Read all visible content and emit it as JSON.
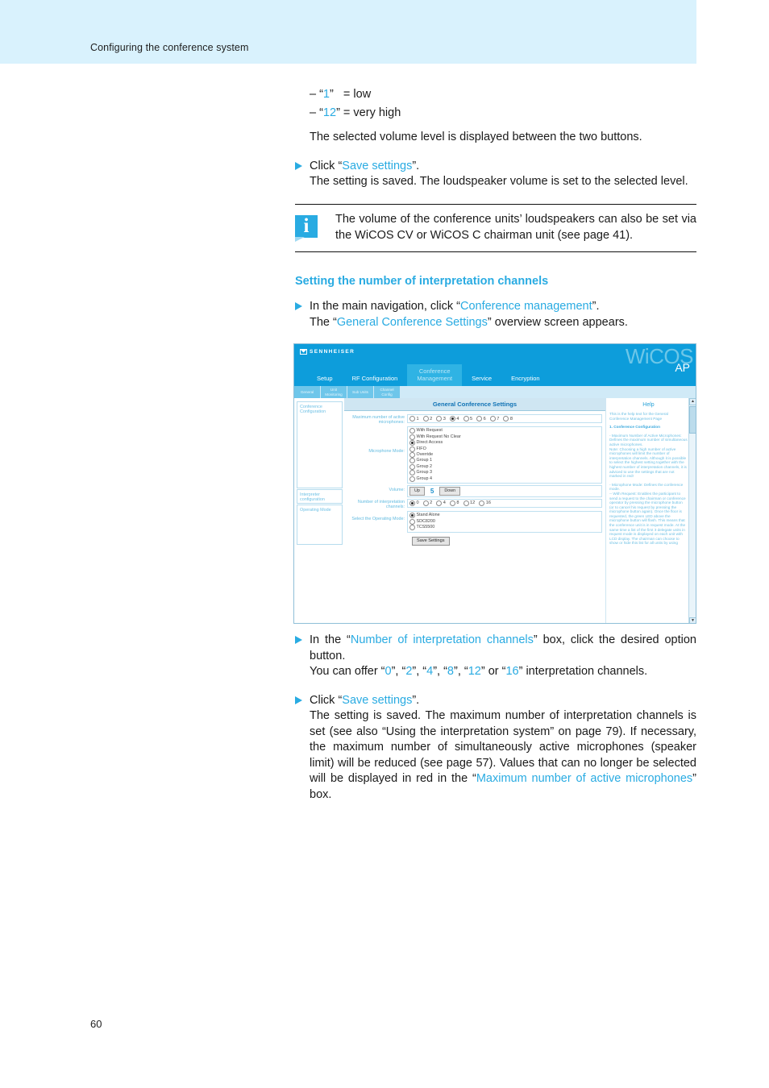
{
  "header": {
    "running_title": "Configuring the conference system"
  },
  "page_number": "60",
  "volume_levels": [
    {
      "dash": "– “",
      "value": "1",
      "close": "”",
      "equals": "   = low"
    },
    {
      "dash": "– “",
      "value": "12",
      "close": "”",
      "equals": " = very high"
    }
  ],
  "intro": {
    "selected_level_note": "The selected volume level is displayed between the two buttons."
  },
  "steps": {
    "save_click_prefix": "Click “",
    "save_link": "Save settings",
    "save_click_suffix": "”.",
    "save_result_1": "The setting is saved. The loudspeaker volume is set to the selected level.",
    "nav_prefix": "In the main navigation, click “",
    "nav_link": "Conference management",
    "nav_suffix": "”.",
    "nav_result_prefix": "The “",
    "nav_result_link": "General Conference Settings",
    "nav_result_suffix": "” overview screen appears.",
    "channels_prefix": "In the “",
    "channels_link": "Number of interpretation channels",
    "channels_suffix": "” box, click the desired option button.",
    "channels_offer_prefix": "You can offer “",
    "channels_offer_values": [
      "0",
      "2",
      "4",
      "8",
      "12",
      "16"
    ],
    "channels_offer_suffix": "” interpretation channels.",
    "save_result_2_a": "The setting is saved. The maximum number of interpretation channels is set (see also “Using the interpretation system” on page 79). If necessary, the maximum number of simultaneously active microphones (speaker limit) will be reduced (see page 57). Values that can no longer be selected will be displayed in red in the “",
    "save_result_2_link": "Maximum number of active microphones",
    "save_result_2_b": "” box."
  },
  "note": {
    "icon": "info-icon",
    "glyph": "i",
    "text": "The volume of the conference units’ loudspeakers can also be set via the WiCOS CV or WiCOS C chairman unit (see page 41)."
  },
  "section": {
    "heading": "Setting the number of interpretation channels"
  },
  "screenshot": {
    "brand": "SENNHEISER",
    "product": "WiCOS",
    "product_variant": "AP",
    "tabs": [
      {
        "label": "Setup",
        "active": false
      },
      {
        "label": "RF Configuration",
        "active": false
      },
      {
        "label": "Conference\nManagement",
        "active": true
      },
      {
        "label": "Service",
        "active": false
      },
      {
        "label": "Encryption",
        "active": false
      }
    ],
    "subtabs": [
      "General",
      "Unit\nMonitoring",
      "Sub Units",
      "Channel\nConfig"
    ],
    "sidebar": [
      "Conference\nConfiguration",
      "Interpreter\nconfiguration",
      "Operating Mode"
    ],
    "panel_title": "General Conference Settings",
    "fields": {
      "max_mics_label": "Maximum number of active\nmicrophones:",
      "max_mics_options": [
        "1",
        "2",
        "3",
        "4",
        "5",
        "6",
        "7",
        "8"
      ],
      "max_mics_selected": "4",
      "mic_mode_label": "Microphone Mode:",
      "mic_mode_options": [
        "With Request",
        "With Request No Clear",
        "Direct Access",
        "FIFO",
        "Override",
        "Group 1",
        "Group 2",
        "Group 3",
        "Group 4"
      ],
      "mic_mode_selected": "Direct Access",
      "volume_label": "Volume:",
      "volume_up": "Up",
      "volume_value": "5",
      "volume_down": "Down",
      "channels_label": "Number of interpretation\nchannels:",
      "channels_options": [
        "0",
        "2",
        "4",
        "8",
        "12",
        "16"
      ],
      "channels_selected": "0",
      "operating_mode_label": "Select the Operating Mode:",
      "operating_mode_options": [
        "Stand Alone",
        "SDC8200",
        "TCS5500"
      ],
      "operating_mode_selected": "Stand Alone",
      "save_button": "Save Settings"
    },
    "help": {
      "title": "Help",
      "body": "This is the help text for the General Conference Management Page",
      "section_1": "1. Conference Configuration",
      "para_1": "- Maximum Number of Active Microphones: Defines the maximum number of simultaneous active microphones.\nNote: Choosing a high number of active microphones will limit the number of interpretation channels. Although it is possible to select the highest setting together with the highest number of interpretation channels, it is adviced to use the settings that are not marked in red!",
      "para_2": "- Microphone Mode: Defines the conference mode.\n-- With Request: Enables the participant to send a request to the chairman or conference operator by pressing the microphone button (or to cancel his request by pressing the microphone button again). Once the floor is requested, the green LED above the microphone button will flash. This means that the conference unit is in request mode. At the same time a list of the first 3 delegate units in request mode is displayed on each unit with LCD display. The chairman can choose to show or hide this list for all units by using"
    }
  }
}
